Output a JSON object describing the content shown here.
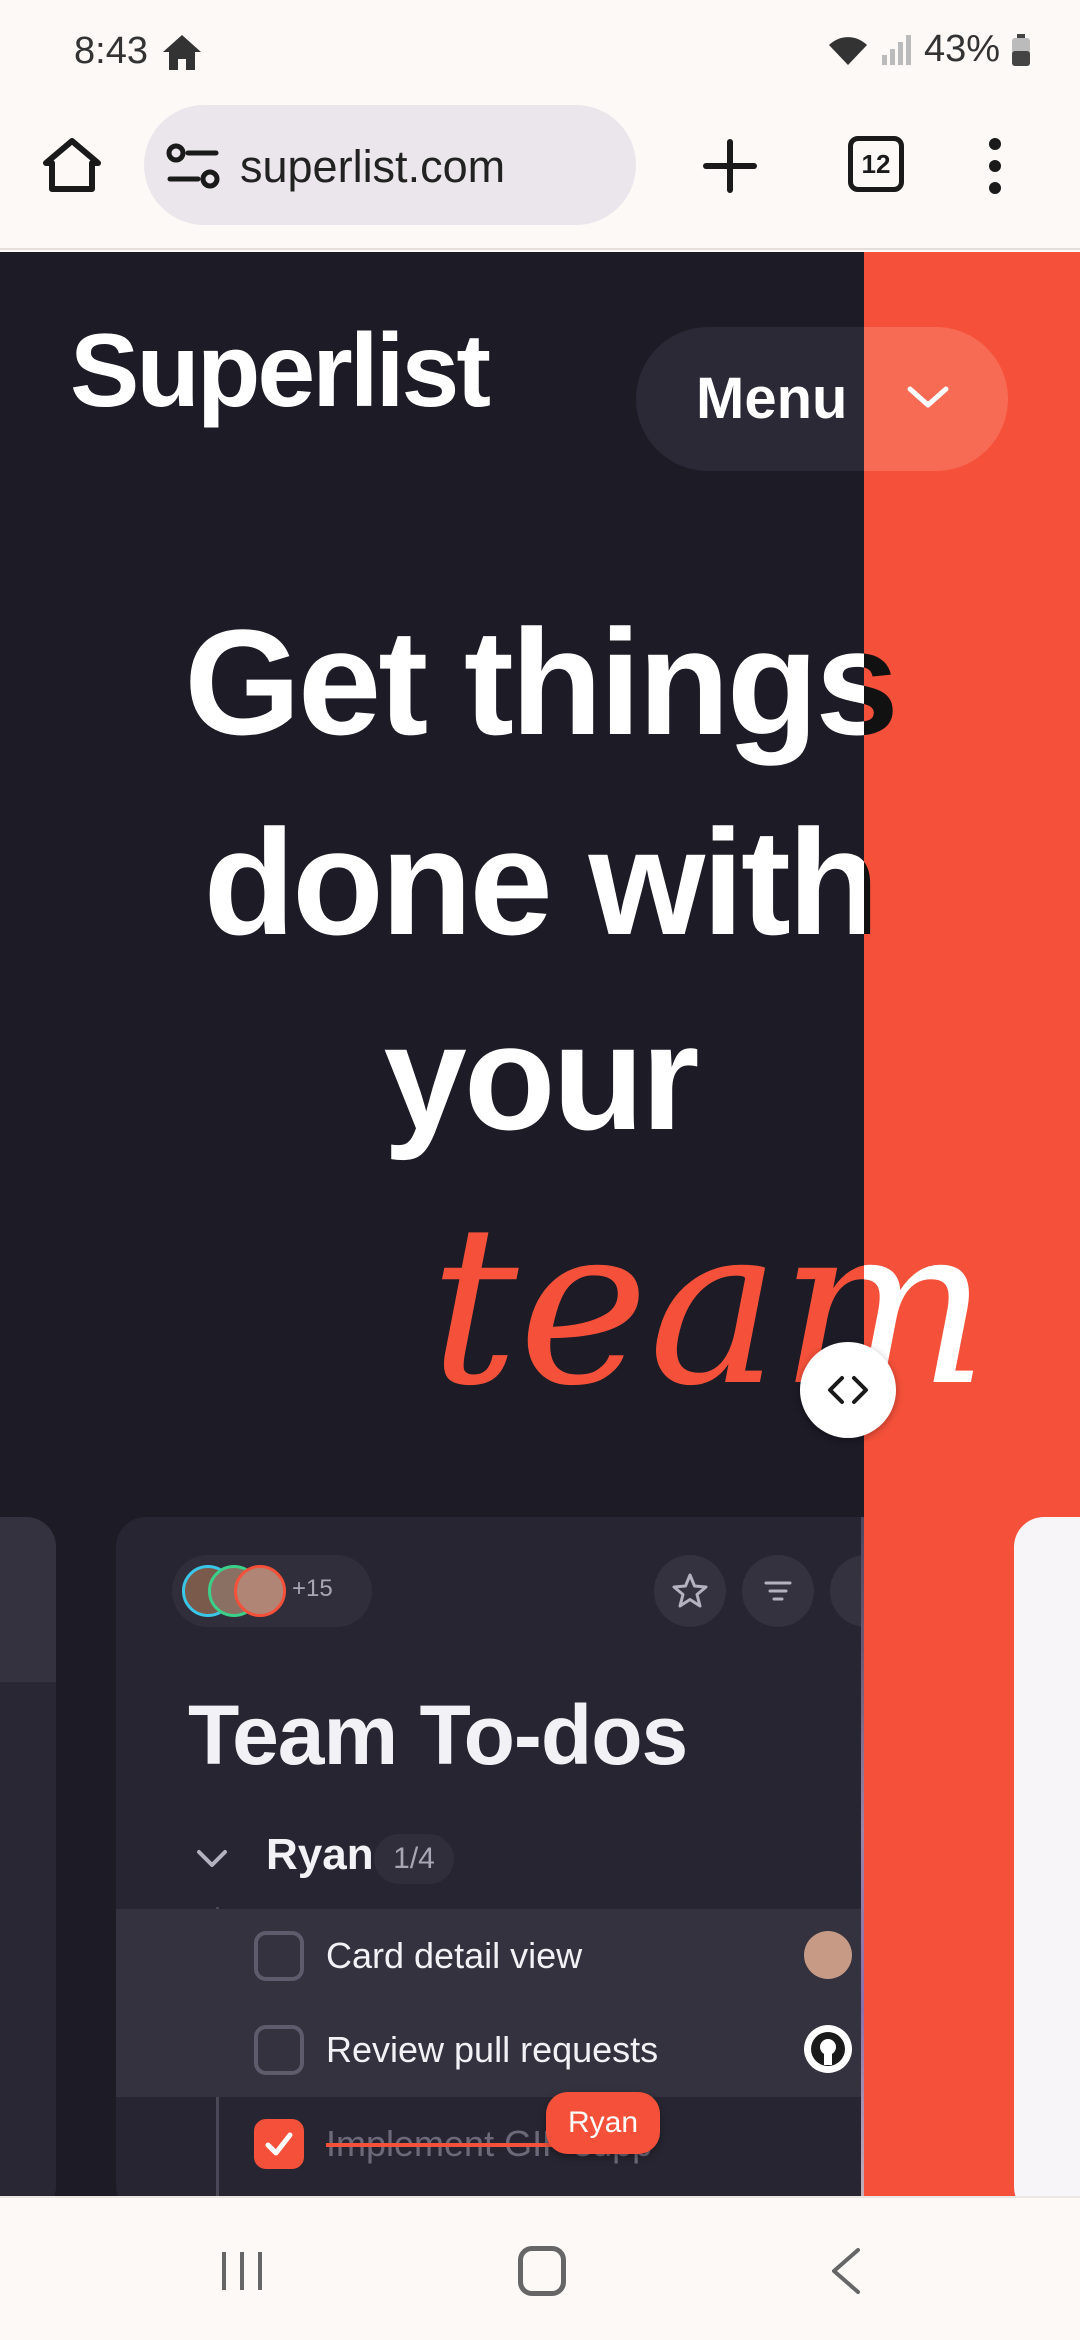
{
  "status_bar": {
    "time": "8:43",
    "battery": "43%",
    "icons": [
      "home-icon",
      "wifi-icon",
      "signal-icon",
      "battery-icon"
    ]
  },
  "browser": {
    "url": "superlist.com",
    "tab_count": "12",
    "icons": [
      "home-icon",
      "site-settings-icon",
      "new-tab-icon",
      "tabs-icon",
      "more-icon"
    ]
  },
  "site": {
    "logo": "Superlist",
    "menu_label": "Menu",
    "hero": {
      "line1": "Get things",
      "line2": "done with",
      "line3": "your",
      "script_word": "team"
    },
    "colors": {
      "background": "#1c1b26",
      "accent": "#f5513a",
      "text": "#ffffff"
    }
  },
  "card": {
    "avatar_extra": "+15",
    "title": "Team To-dos",
    "group": {
      "name": "Ryan",
      "count": "1/4"
    },
    "tasks": [
      {
        "label": "Card detail view",
        "done": false
      },
      {
        "label": "Review pull requests",
        "done": false
      },
      {
        "label": "Implement GIF supp",
        "done": true
      }
    ],
    "tooltip": "Ryan"
  },
  "nav": {
    "icons": [
      "recents-icon",
      "home-icon",
      "back-icon"
    ]
  }
}
